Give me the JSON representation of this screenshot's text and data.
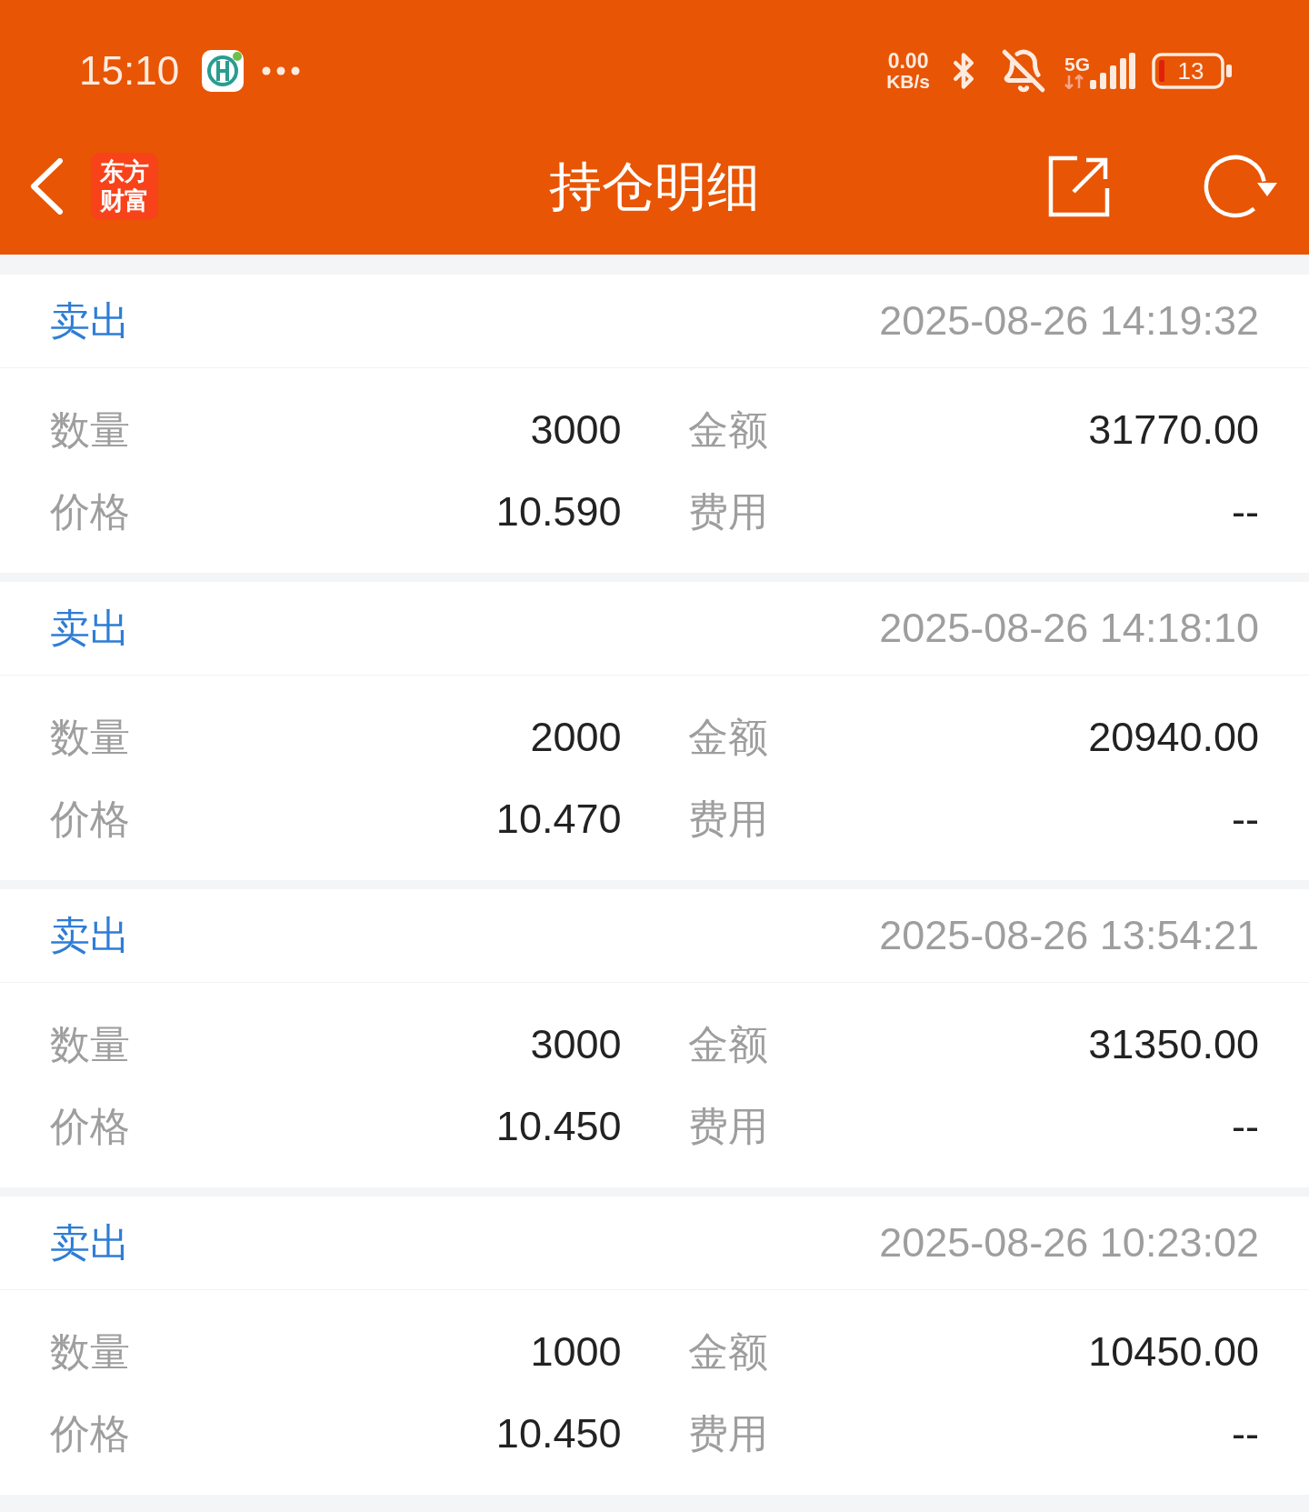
{
  "status_bar": {
    "time": "15:10",
    "net_speed": {
      "value": "0.00",
      "unit": "KB/s"
    },
    "network_type": "5G",
    "battery": "13"
  },
  "nav_bar": {
    "logo": "东方财富",
    "title": "持仓明细"
  },
  "records": [
    {
      "side": "卖出",
      "time": "2025-08-26 14:19:32",
      "fields": [
        {
          "label": "数量",
          "value": "3000"
        },
        {
          "label": "金额",
          "value": "31770.00"
        },
        {
          "label": "价格",
          "value": "10.590"
        },
        {
          "label": "费用",
          "value": "--"
        }
      ]
    },
    {
      "side": "卖出",
      "time": "2025-08-26 14:18:10",
      "fields": [
        {
          "label": "数量",
          "value": "2000"
        },
        {
          "label": "金额",
          "value": "20940.00"
        },
        {
          "label": "价格",
          "value": "10.470"
        },
        {
          "label": "费用",
          "value": "--"
        }
      ]
    },
    {
      "side": "卖出",
      "time": "2025-08-26 13:54:21",
      "fields": [
        {
          "label": "数量",
          "value": "3000"
        },
        {
          "label": "金额",
          "value": "31350.00"
        },
        {
          "label": "价格",
          "value": "10.450"
        },
        {
          "label": "费用",
          "value": "--"
        }
      ]
    },
    {
      "side": "卖出",
      "time": "2025-08-26 10:23:02",
      "fields": [
        {
          "label": "数量",
          "value": "1000"
        },
        {
          "label": "金额",
          "value": "10450.00"
        },
        {
          "label": "价格",
          "value": "10.450"
        },
        {
          "label": "费用",
          "value": "--"
        }
      ]
    }
  ]
}
